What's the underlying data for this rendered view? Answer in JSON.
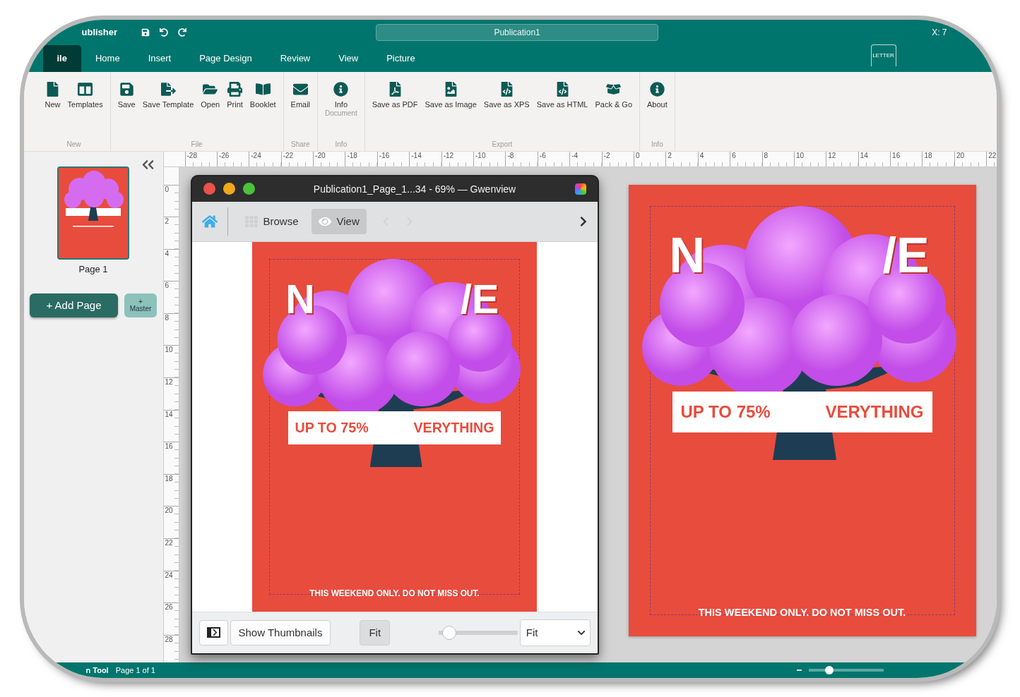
{
  "app": {
    "title": "ublisher",
    "document_title": "Publication1",
    "coordinates": "X: 7"
  },
  "menu_tabs": [
    {
      "label": "ile",
      "selected": true
    },
    {
      "label": "Home",
      "selected": false
    },
    {
      "label": "Insert",
      "selected": false
    },
    {
      "label": "Page Design",
      "selected": false
    },
    {
      "label": "Review",
      "selected": false
    },
    {
      "label": "View",
      "selected": false
    },
    {
      "label": "Picture",
      "selected": false
    }
  ],
  "page_size": "LETTER",
  "ribbon_groups": [
    {
      "label": "New",
      "items": [
        {
          "label": "New"
        },
        {
          "label": "Templates"
        }
      ]
    },
    {
      "label": "File",
      "items": [
        {
          "label": "Save"
        },
        {
          "label": "Save Template"
        },
        {
          "label": "Open"
        },
        {
          "label": "Print"
        },
        {
          "label": "Booklet"
        }
      ]
    },
    {
      "label": "Share",
      "items": [
        {
          "label": "Email"
        }
      ]
    },
    {
      "label": "Info",
      "items": [
        {
          "label": "Info",
          "sublabel": "Document"
        }
      ]
    },
    {
      "label": "Export",
      "items": [
        {
          "label": "Save as PDF"
        },
        {
          "label": "Save as Image"
        },
        {
          "label": "Save as XPS"
        },
        {
          "label": "Save as HTML"
        },
        {
          "label": "Pack & Go"
        }
      ]
    },
    {
      "label": "Info",
      "items": [
        {
          "label": "About"
        }
      ]
    }
  ],
  "ruler": {
    "horizontal": [
      "-28",
      "-26",
      "-24",
      "-22",
      "-20",
      "-18",
      "-16",
      "-14",
      "-12",
      "-10",
      "-8",
      "-6",
      "-4",
      "-2",
      "0",
      "2",
      "4",
      "6",
      "8",
      "10",
      "12",
      "14",
      "16",
      "18",
      "20",
      "22"
    ],
    "vertical": [
      "0",
      "2",
      "4",
      "6",
      "8",
      "10",
      "12",
      "14",
      "16",
      "18",
      "20",
      "22",
      "24",
      "26",
      "28"
    ]
  },
  "sidebar": {
    "pages": [
      {
        "label": "Page 1",
        "selected": true
      }
    ],
    "add_page": "+ Add Page",
    "master_plus": "+",
    "master": "Master"
  },
  "posters": [
    {
      "headline_left": "N",
      "headline_right": "/E",
      "banner_left": "UP TO 75%",
      "banner_right": "VERYTHING",
      "tagline": "THIS WEEKEND ONLY. DO NOT MISS OUT."
    },
    {
      "headline_left": "N",
      "headline_right": "/E",
      "banner_left": "UP TO 75%",
      "banner_right": "VERYTHING",
      "tagline": "THIS WEEKEND ONLY. DO NOT MISS OUT."
    }
  ],
  "viewer": {
    "title": "Publication1_Page_1...34 - 69% — Gwenview",
    "modes": [
      {
        "label": "Browse",
        "selected": false
      },
      {
        "label": "View",
        "selected": true
      }
    ],
    "show_thumbnails": "Show Thumbnails",
    "fit_button": "Fit",
    "zoom": {
      "level": 0.05
    },
    "zoom_mode": "Fit"
  },
  "status_bar": {
    "tool": "n Tool",
    "page": "Page 1 of 1",
    "zoom": {
      "level": 0.25
    }
  }
}
